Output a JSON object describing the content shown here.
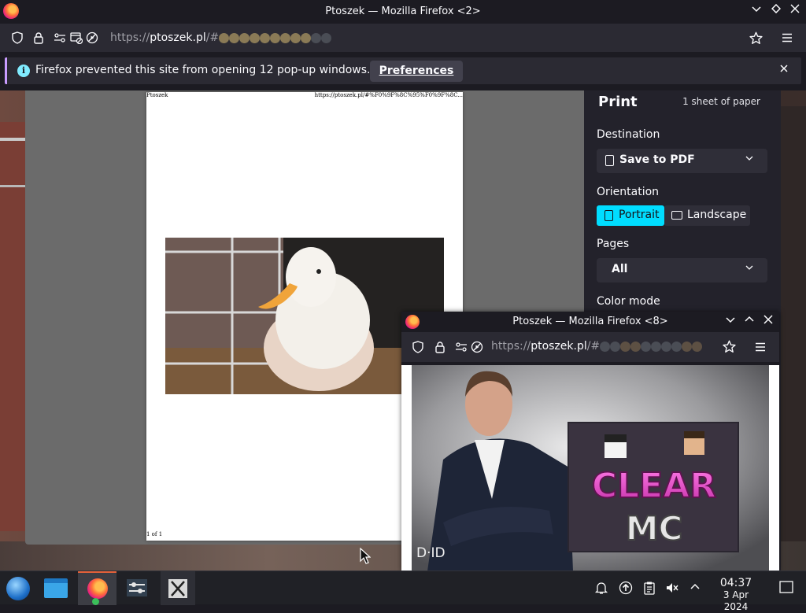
{
  "main_window": {
    "title": "Ptoszek — Mozilla Firefox <2>",
    "url_scheme": "https://",
    "url_host": "ptoszek.pl",
    "url_rest": "/#"
  },
  "notification": {
    "message": "Firefox prevented this site from opening 12 pop-up windows.",
    "button_label": "Preferences",
    "close_label": "×"
  },
  "print_preview": {
    "header_left": "Ptoszek",
    "header_right": "https://ptoszek.pl/#%F0%9F%8C%95%F0%9F%8C...",
    "footer": "1 of 1"
  },
  "print_panel": {
    "title": "Print",
    "sheets": "1 sheet of paper",
    "destination_label": "Destination",
    "destination_value": "Save to PDF",
    "orientation_label": "Orientation",
    "portrait_label": "Portrait",
    "landscape_label": "Landscape",
    "orientation_selected": "Portrait",
    "pages_label": "Pages",
    "pages_value": "All",
    "color_mode_label": "Color mode"
  },
  "popup_window": {
    "title": "Ptoszek — Mozilla Firefox <8>",
    "url_scheme": "https://",
    "url_host": "ptoszek.pl",
    "url_rest": "/#",
    "logo_text": "D·ID",
    "banner_line1": "CLEAR",
    "banner_line2": "MC"
  },
  "taskbar": {
    "time": "04:37",
    "date": "3 Apr 2024"
  },
  "colors": {
    "accent": "#00ddff",
    "notification_border": "#c99cff",
    "info_icon": "#80ebff",
    "toolbar": "#2b2a33",
    "titlebar": "#1c1b22"
  }
}
